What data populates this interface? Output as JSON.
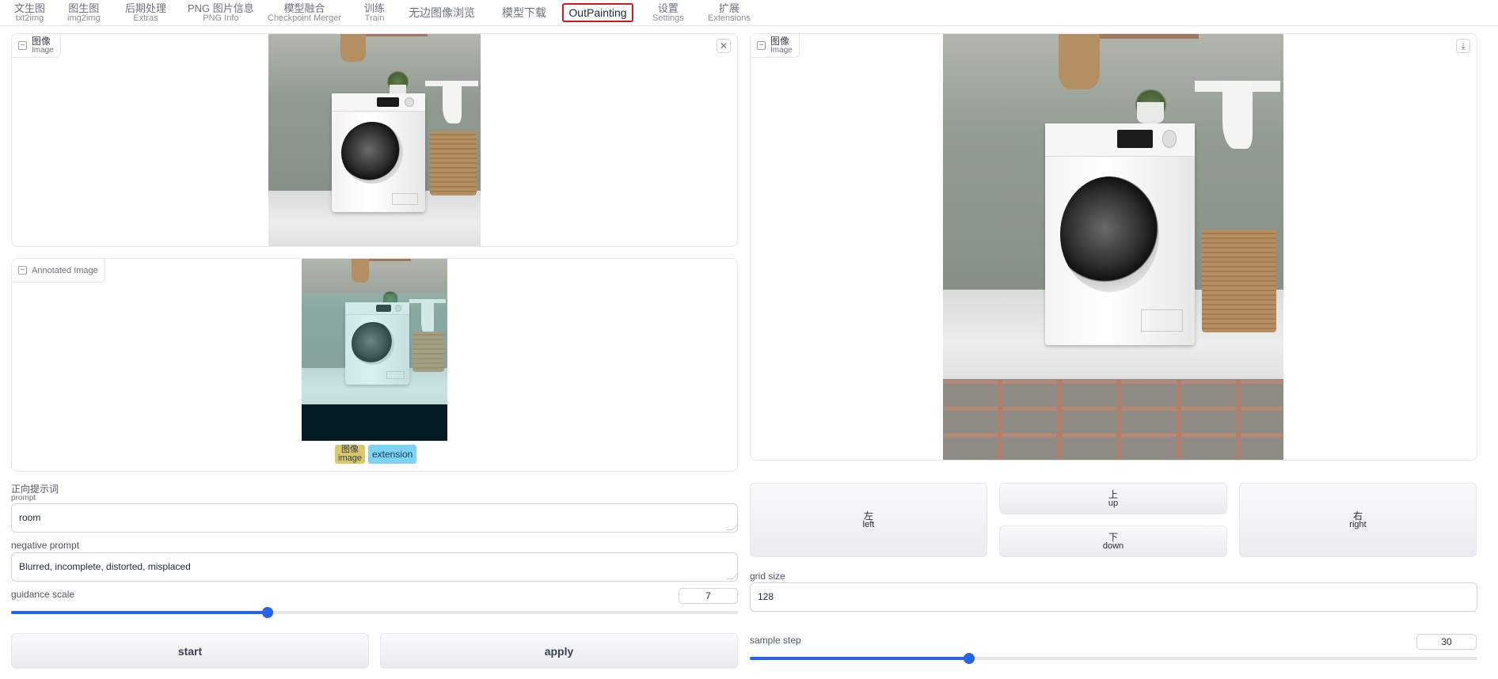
{
  "tabs": [
    {
      "zh": "文生图",
      "en": "txt2img"
    },
    {
      "zh": "图生图",
      "en": "img2img"
    },
    {
      "zh": "后期处理",
      "en": "Extras"
    },
    {
      "zh": "PNG 图片信息",
      "en": "PNG Info"
    },
    {
      "zh": "模型融合",
      "en": "Checkpoint Merger"
    },
    {
      "zh": "训练",
      "en": "Train"
    },
    {
      "single": "无边图像浏览"
    },
    {
      "single": "模型下载"
    },
    {
      "single": "OutPainting"
    },
    {
      "zh": "设置",
      "en": "Settings"
    },
    {
      "zh": "扩展",
      "en": "Extensions"
    }
  ],
  "active_tab": "OutPainting",
  "input_image": {
    "label_zh": "图像",
    "label_en": "Image",
    "clear_icon": "close-icon"
  },
  "annotated_image": {
    "label": "Annotated Image"
  },
  "legend": {
    "image_zh": "图像",
    "image_en": "image",
    "extension": "extension",
    "image_color": "#d9c86a",
    "extension_color": "#7cd3f5"
  },
  "output_image": {
    "label_zh": "图像",
    "label_en": "Image",
    "download_icon": "download-icon"
  },
  "prompt": {
    "label_zh": "正向提示词",
    "label_en": "prompt",
    "value": "room"
  },
  "negative_prompt": {
    "label": "negative prompt",
    "value": "Blurred, incomplete, distorted, misplaced"
  },
  "guidance_scale": {
    "label": "guidance scale",
    "value": "7",
    "fraction": 0.353
  },
  "buttons": {
    "start": "start",
    "apply": "apply"
  },
  "direction": {
    "left_zh": "左",
    "left_en": "left",
    "up_zh": "上",
    "up_en": "up",
    "down_zh": "下",
    "down_en": "down",
    "right_zh": "右",
    "right_en": "right"
  },
  "grid_size": {
    "label": "grid size",
    "value": "128"
  },
  "sample_step": {
    "label": "sample step",
    "value": "30",
    "fraction": 0.301
  },
  "colors": {
    "accent": "#2563eb",
    "active_tab_border": "#d11a1a"
  }
}
